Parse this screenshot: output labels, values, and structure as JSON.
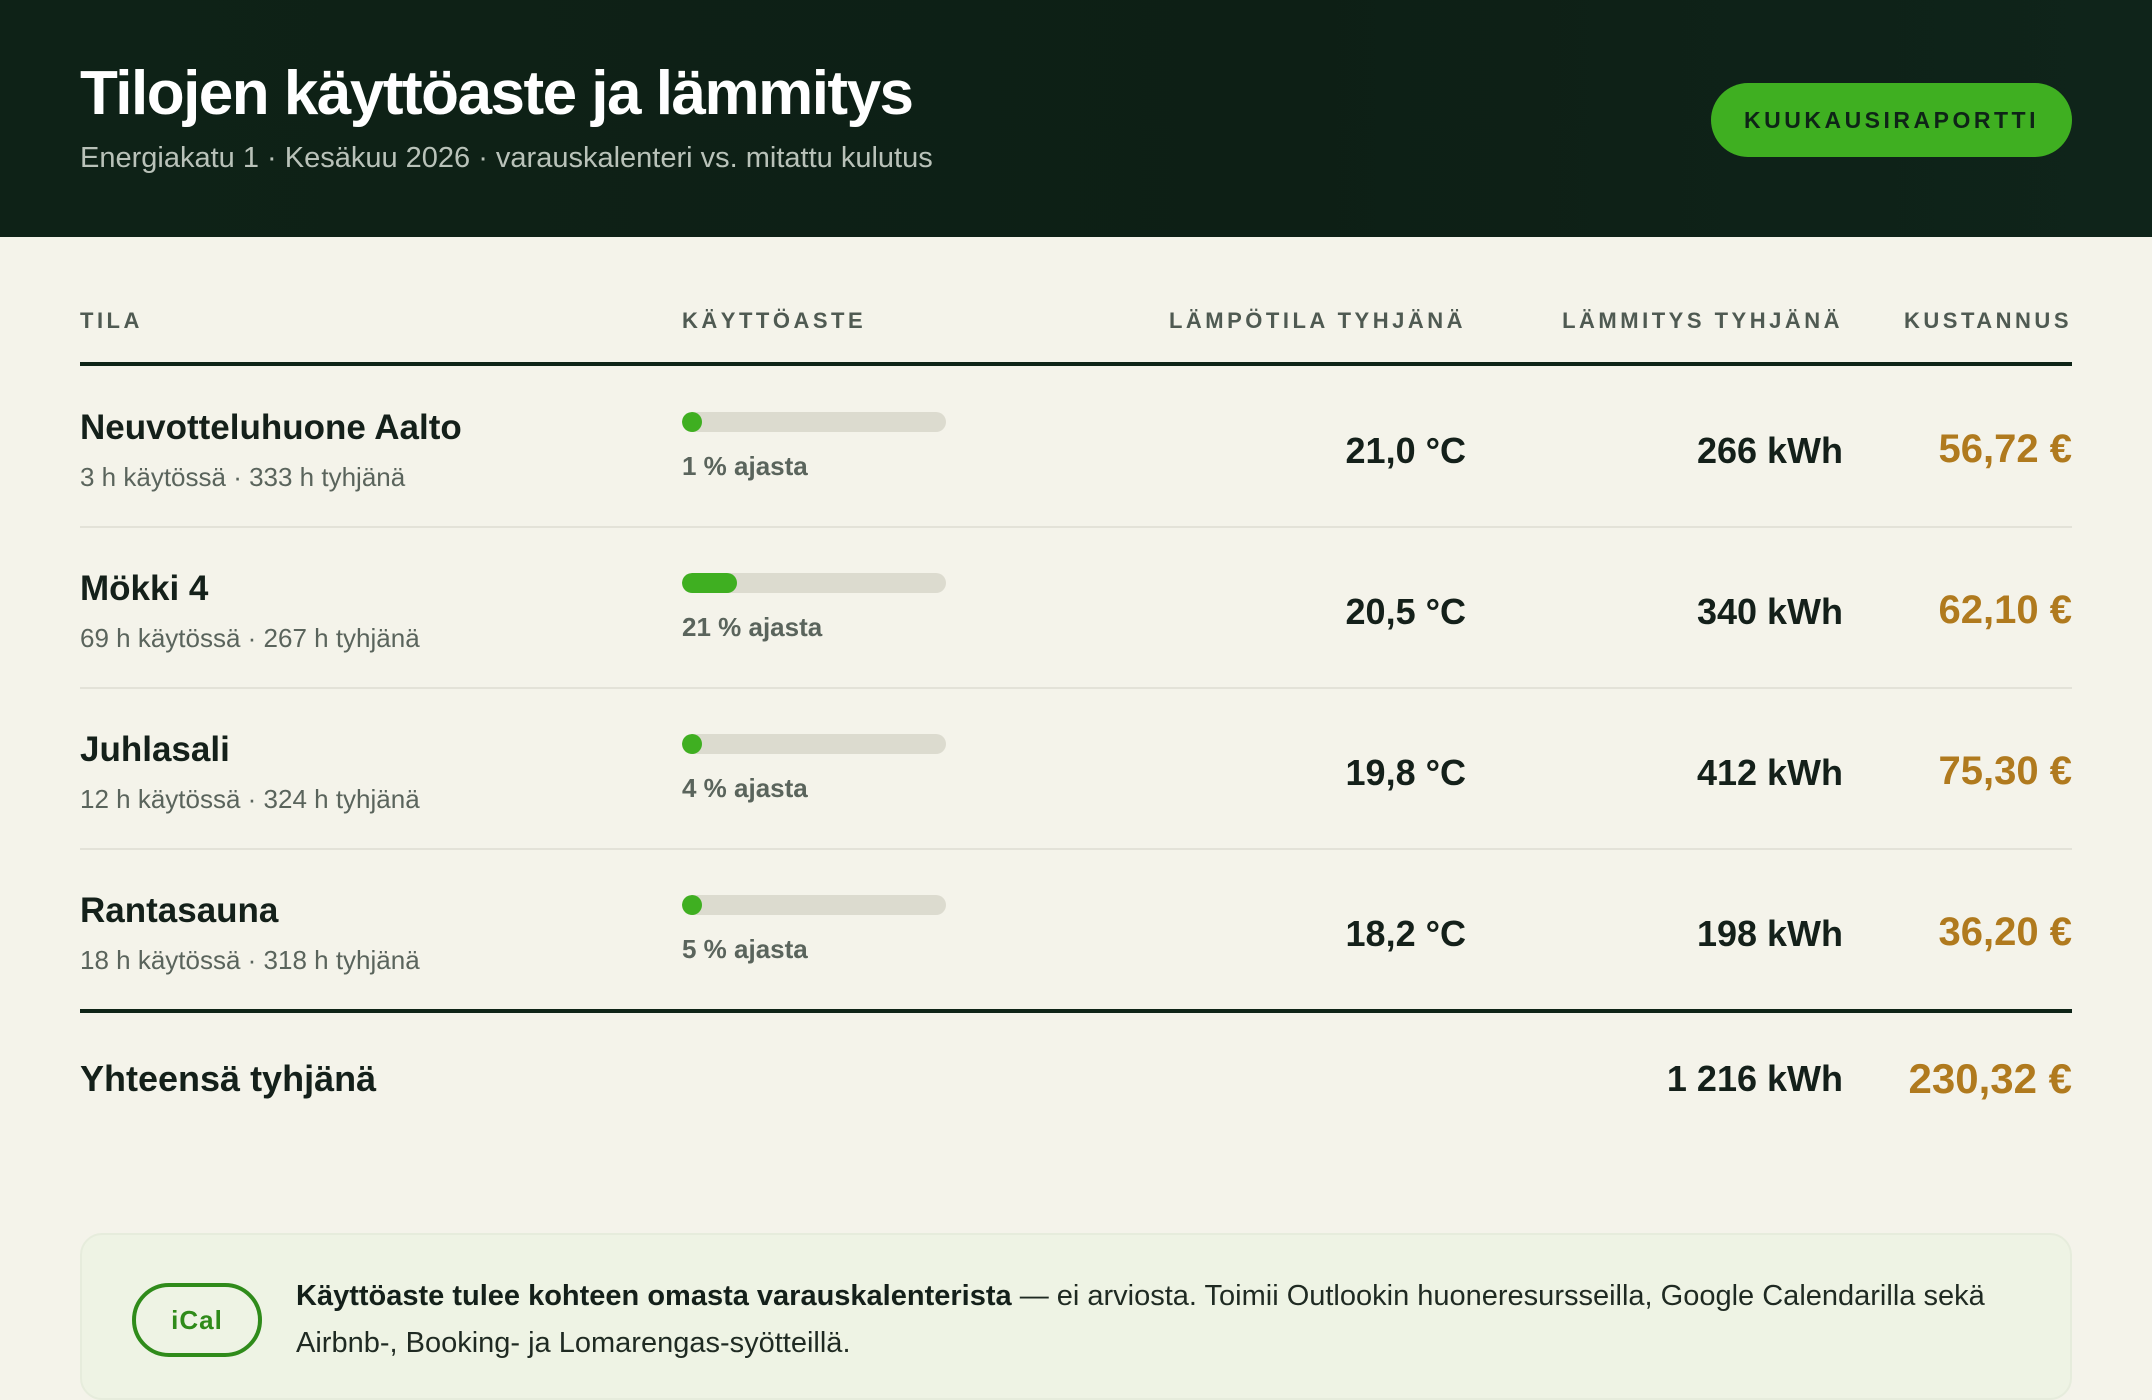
{
  "header": {
    "title": "Tilojen käyttöaste ja lämmitys",
    "subtitle": "Energiakatu 1 · Kesäkuu 2026 · varauskalenteri vs. mitattu kulutus",
    "report_button": "KUUKAUSIRAPORTTI"
  },
  "table": {
    "columns": {
      "room": "TILA",
      "occupancy": "KÄYTTÖASTE",
      "temp_empty": "LÄMPÖTILA TYHJÄNÄ",
      "heating_empty": "LÄMMITYS TYHJÄNÄ",
      "cost": "KUSTANNUS"
    },
    "rows": [
      {
        "name": "Neuvotteluhuone Aalto",
        "hours": "3 h käytössä · 333 h tyhjänä",
        "occupancy_pct": 1,
        "occupancy_label": "1 % ajasta",
        "temp": "21,0 °C",
        "kwh": "266 kWh",
        "cost": "56,72 €"
      },
      {
        "name": "Mökki 4",
        "hours": "69 h käytössä · 267 h tyhjänä",
        "occupancy_pct": 21,
        "occupancy_label": "21 % ajasta",
        "temp": "20,5 °C",
        "kwh": "340 kWh",
        "cost": "62,10 €"
      },
      {
        "name": "Juhlasali",
        "hours": "12 h käytössä · 324 h tyhjänä",
        "occupancy_pct": 4,
        "occupancy_label": "4 % ajasta",
        "temp": "19,8 °C",
        "kwh": "412 kWh",
        "cost": "75,30 €"
      },
      {
        "name": "Rantasauna",
        "hours": "18 h käytössä · 318 h tyhjänä",
        "occupancy_pct": 5,
        "occupancy_label": "5 % ajasta",
        "temp": "18,2 °C",
        "kwh": "198 kWh",
        "cost": "36,20 €"
      }
    ],
    "total": {
      "label": "Yhteensä tyhjänä",
      "kwh": "1 216 kWh",
      "cost": "230,32 €"
    }
  },
  "note": {
    "badge": "iCal",
    "bold": "Käyttöaste tulee kohteen omasta varauskalenterista",
    "text": " — ei arviosta. Toimii Outlookin huoneresursseilla, Google Calendarilla sekä Airbnb-, Booking- ja Lomarengas-syötteillä."
  },
  "colors": {
    "header_bg": "#0e2217",
    "accent_green": "#3faf21",
    "cost": "#b07a1e",
    "page_bg": "#f4f3ea"
  }
}
